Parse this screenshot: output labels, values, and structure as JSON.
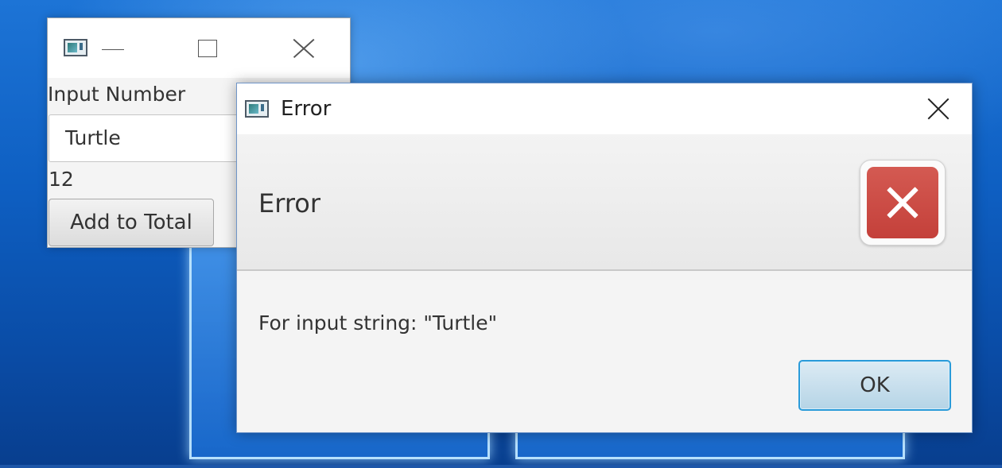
{
  "main_window": {
    "title": "",
    "input_label": "Input Number",
    "input_value": "Turtle",
    "total_value": "12",
    "add_button_label": "Add to Total"
  },
  "error_dialog": {
    "title": "Error",
    "header_text": "Error",
    "content_text": "For input string: \"Turtle\"",
    "ok_button_label": "OK",
    "icon": "error-x-icon",
    "icon_color": "#c9463f",
    "ok_focus_color": "#2a9bd9"
  },
  "desktop": {
    "wallpaper": "windows-10-logo",
    "accent_color": "#0e5fc2"
  }
}
